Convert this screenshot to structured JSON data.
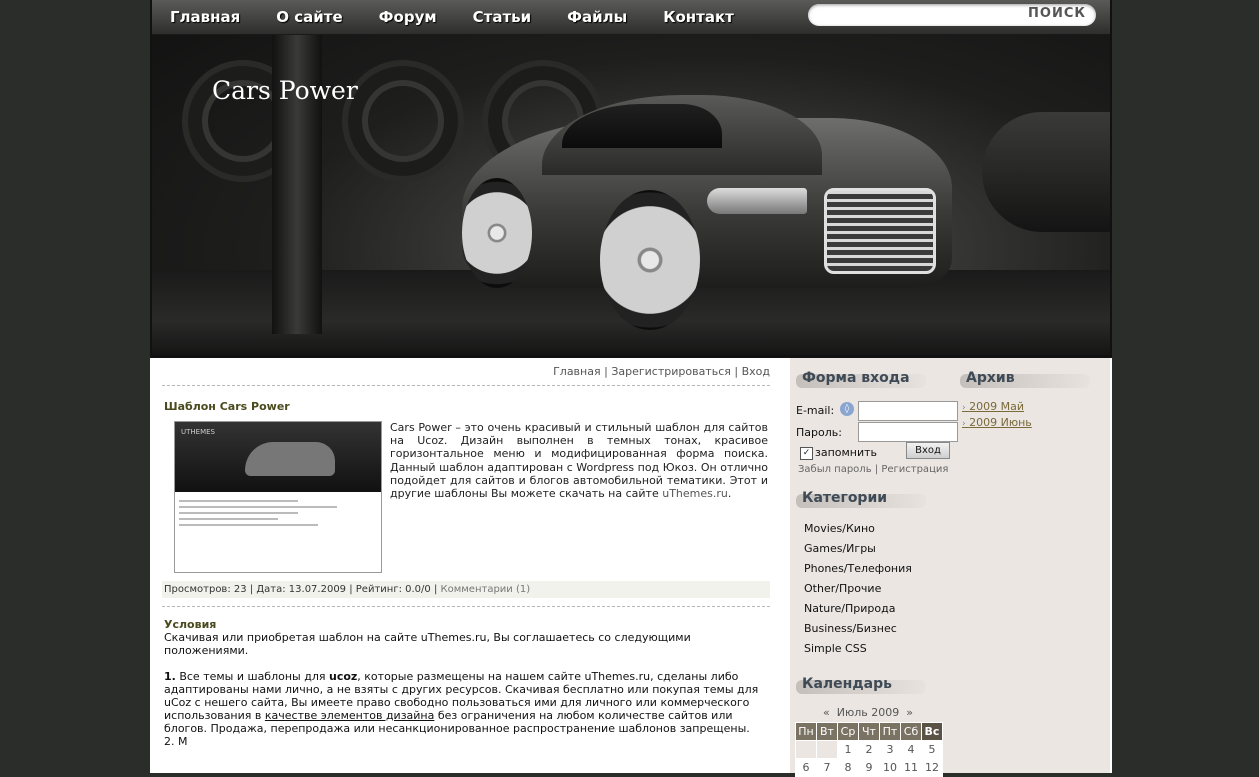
{
  "nav": {
    "items": [
      "Главная",
      "О сайте",
      "Форум",
      "Статьи",
      "Файлы",
      "Контакт"
    ]
  },
  "search": {
    "button_label": "ПОИСК",
    "value": ""
  },
  "site": {
    "title": "Cars Power"
  },
  "userbar": {
    "home": "Главная",
    "register": "Зарегистрироваться",
    "login": "Вход",
    "sep": "|"
  },
  "entry": {
    "title": "Шаблон Cars Power",
    "text": "Cars Power – это очень красивый и стильный шаблон для сайтов на Ucoz. Дизайн выполнен в темных тонах, красивое горизонтальное меню и модифицированная форма поиска. Данный шаблон адаптирован с Wordpress под Юкоз. Он отлично подойдет для сайтов и блогов автомобильной тематики. Этот и другие шаблоны Вы можете скачать на сайте ",
    "link": "uThemes.ru",
    "link_suffix": ".",
    "thumb_label": "UTHEMES",
    "details": {
      "views": "Просмотров: 23",
      "date": "Дата: 13.07.2009",
      "rating": "Рейтинг: 0.0/0",
      "comments": "Комментарии (1)"
    }
  },
  "conditions": {
    "title": "Условия",
    "intro": "Скачивая или приобретая шаблон на сайте uThemes.ru, Вы соглашаетесь со следующими положениями.",
    "p1_num": "1.",
    "p1_a": " Все темы и шаблоны для ",
    "p1_b": "ucoz",
    "p1_c": ", которые размещены на нашем сайте uThemes.ru, сделаны либо адаптированы нами лично, а не взяты с других ресурсов. Скачивая бесплатно или покупая темы для uCoz с нешего сайта, Вы имеете право свободно пользоваться ими для личного или коммерческого использования в ",
    "p1_link": "качестве элементов дизайна",
    "p1_d": " без ограничения на любом количестве сайтов или блогов. Продажа, перепродажа или несанкционированное распространение шаблонов запрещены.",
    "p2_partial": "2. М"
  },
  "login_form": {
    "title": "Форма входа",
    "email_label": "E-mail:",
    "password_label": "Пароль:",
    "remember_label": "запомнить",
    "submit_label": "Вход",
    "forgot": "Забыл пароль",
    "register": "Регистрация",
    "email_value": "",
    "password_value": ""
  },
  "archive": {
    "title": "Архив",
    "items": [
      "2009 Май",
      "2009 Июнь"
    ]
  },
  "categories": {
    "title": "Категории",
    "items": [
      "Movies/Кино",
      "Games/Игры",
      "Phones/Телефония",
      "Other/Прочие",
      "Nature/Природа",
      "Business/Бизнес",
      "Simple CSS"
    ]
  },
  "calendar": {
    "title": "Календарь",
    "month": "Июль 2009",
    "prev": "«",
    "next": "»",
    "days": [
      "Пн",
      "Вт",
      "Ср",
      "Чт",
      "Пт",
      "Сб",
      "Вс"
    ],
    "week1": [
      "",
      "",
      "1",
      "2",
      "3",
      "4",
      "5"
    ],
    "week2": [
      "6",
      "7",
      "8",
      "9",
      "10",
      "11",
      "12"
    ]
  }
}
